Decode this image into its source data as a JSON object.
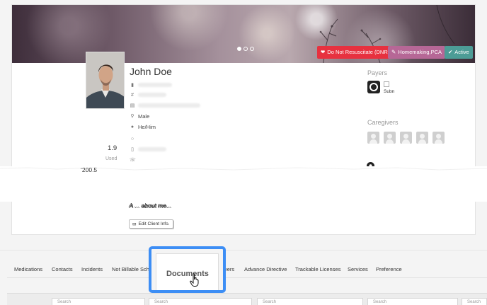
{
  "client": {
    "name": "John Doe",
    "gender": "Male",
    "pronouns": "He/Him",
    "about": "A ... about me...",
    "edit_button_label": "Edit Client Info."
  },
  "badges": {
    "dnr": "Do Not Resuscitate (DNR)",
    "services": "Homemaking,PCA",
    "status": "Active"
  },
  "stats": {
    "value": "1.9",
    "label": "Used",
    "value2": "ʻ200.5"
  },
  "payers": {
    "title": "Payers",
    "broken_image_alt": "Subn"
  },
  "caregivers": {
    "title": "Caregivers",
    "count": 5
  },
  "tabs": [
    "Medications",
    "Contacts",
    "Incidents",
    "Not Billable Sch",
    "Documents",
    "vers",
    "Advance Directive",
    "Trackable Licenses",
    "Services",
    "Preference"
  ],
  "search_placeholder": "Search",
  "colors": {
    "dnr": "#e7313f",
    "services": "#b66796",
    "active": "#4c9c96",
    "highlight": "#3d8ef5"
  },
  "icons": {
    "gender": "map-marker-icon",
    "pronouns": "user-icon",
    "dnr": "heart-icon",
    "active": "check-icon",
    "services": "tag-icon",
    "location": "location-pin-icon",
    "edit": "envelope-icon",
    "cursor": "hand-pointer-icon"
  }
}
